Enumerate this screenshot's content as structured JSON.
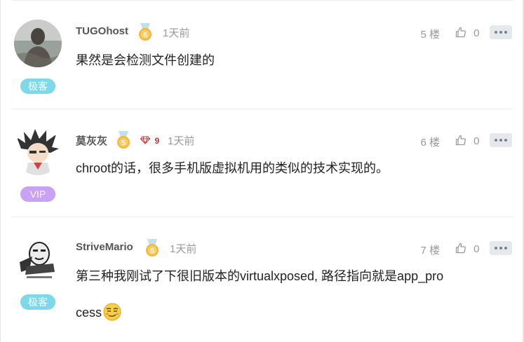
{
  "comments": [
    {
      "username": "TUGOhost",
      "level": "6",
      "time": "1天前",
      "floor": "5 楼",
      "likes": "0",
      "badge": "极客",
      "content": "果然是会检测文件创建的",
      "avatar": "photo-avatar"
    },
    {
      "username": "莫灰灰",
      "level": "5",
      "gem_count": "9",
      "time": "1天前",
      "floor": "6 楼",
      "likes": "0",
      "badge": "VIP",
      "content": "chroot的话，很多手机版虚拟机用的类似的技术实现的。",
      "avatar": "anime-avatar"
    },
    {
      "username": "StriveMario",
      "level": "6",
      "time": "1天前",
      "floor": "7 楼",
      "likes": "0",
      "badge": "极客",
      "content_line1": "第三种我刚试了下很旧版本的virtualxposed, 路径指向就是app_pro",
      "content_line2": "cess",
      "emoji": "smug-emoji",
      "avatar": "meme-avatar"
    }
  ],
  "colors": {
    "badge_geek": "#7dd9ea",
    "badge_vip": "#c9a2f5",
    "medal_gold": "#f6b73c",
    "gem_red": "#c9302c"
  }
}
